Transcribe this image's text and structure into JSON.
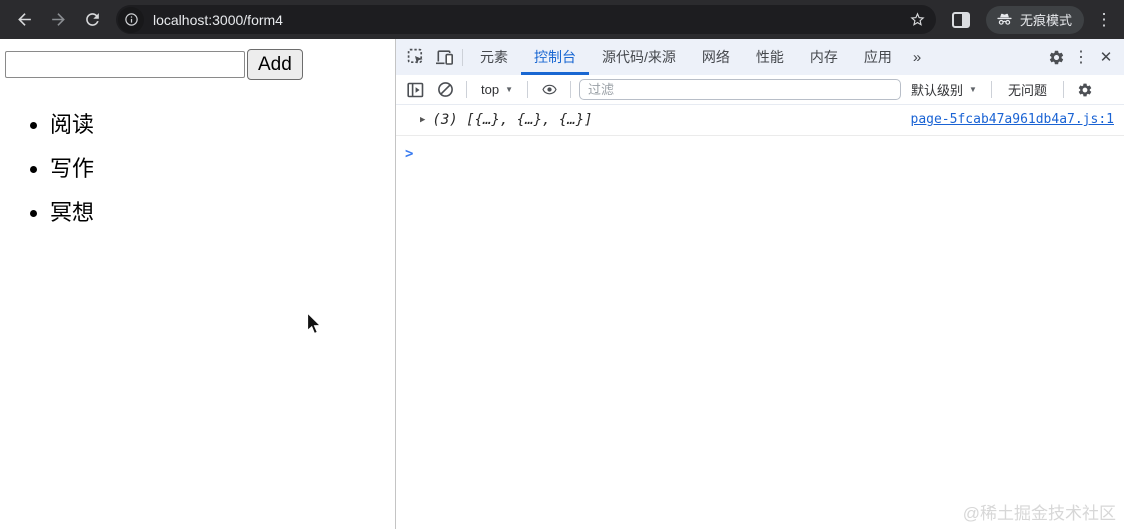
{
  "browser": {
    "url": "localhost:3000/form4",
    "incognito_label": "无痕模式",
    "menu_icon": "⋮"
  },
  "page": {
    "input_value": "",
    "add_button": "Add",
    "list_items": [
      "阅读",
      "写作",
      "冥想"
    ]
  },
  "devtools": {
    "tabs": [
      "元素",
      "控制台",
      "源代码/来源",
      "网络",
      "性能",
      "内存",
      "应用"
    ],
    "selected_tab": "控制台",
    "more_tabs_icon": "»",
    "menu_icon": "⋮",
    "close_icon": "✕",
    "toolbar": {
      "context": "top",
      "caret": "▼",
      "filter_placeholder": "过滤",
      "levels_label": "默认级别",
      "issues_label": "无问题"
    },
    "console": {
      "expander": "▶",
      "log_text": "(3) [{…}, {…}, {…}]",
      "source_link": "page-5fcab47a961db4a7.js:1",
      "prompt": ">"
    }
  },
  "watermark": "@稀土掘金技术社区",
  "colors": {
    "accent_blue": "#1967d2",
    "link_blue": "#1a63d4",
    "prompt_blue": "#3b7cf0",
    "toolbar_dark": "#2b2b2e",
    "omnibox_dark": "#1d1d20",
    "tabbar_bg": "#edf1f9"
  }
}
